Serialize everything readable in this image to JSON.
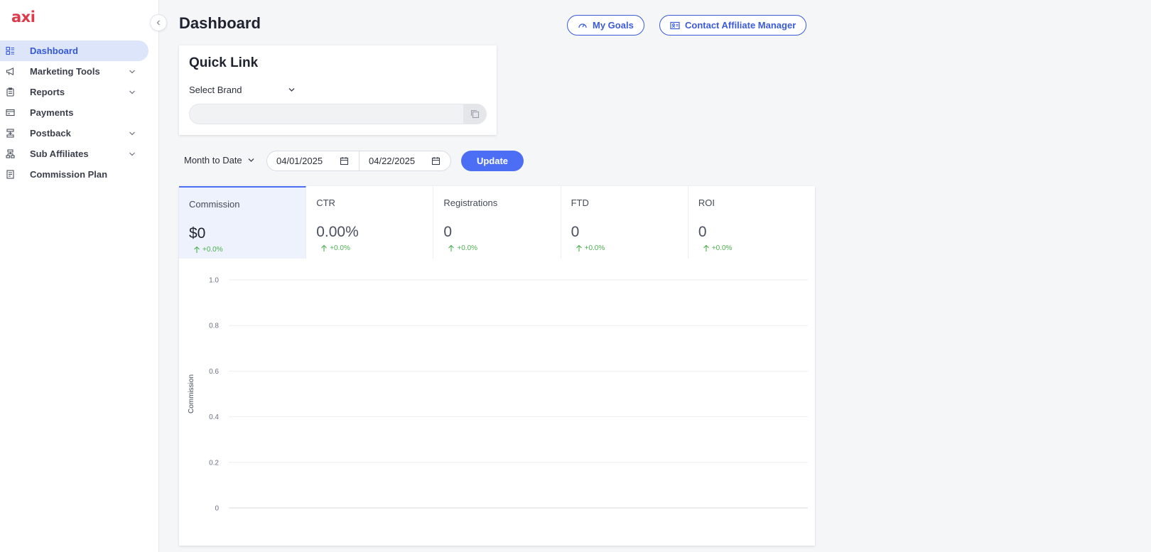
{
  "brand": {
    "logo_text": "axi",
    "color": "#e0394a"
  },
  "sidebar": {
    "items": [
      {
        "label": "Dashboard",
        "icon": "dashboard-icon",
        "expandable": false,
        "active": true
      },
      {
        "label": "Marketing Tools",
        "icon": "megaphone-icon",
        "expandable": true,
        "active": false
      },
      {
        "label": "Reports",
        "icon": "clipboard-icon",
        "expandable": true,
        "active": false
      },
      {
        "label": "Payments",
        "icon": "credit-card-icon",
        "expandable": false,
        "active": false
      },
      {
        "label": "Postback",
        "icon": "postback-icon",
        "expandable": true,
        "active": false
      },
      {
        "label": "Sub Affiliates",
        "icon": "hierarchy-icon",
        "expandable": true,
        "active": false
      },
      {
        "label": "Commission Plan",
        "icon": "document-icon",
        "expandable": false,
        "active": false
      }
    ]
  },
  "header": {
    "title": "Dashboard",
    "my_goals_label": "My Goals",
    "contact_label": "Contact Affiliate Manager"
  },
  "quick_link": {
    "title": "Quick Link",
    "brand_select_label": "Select Brand",
    "link_value": ""
  },
  "filters": {
    "period_label": "Month to Date",
    "start_date": "04/01/2025",
    "end_date": "04/22/2025",
    "update_label": "Update"
  },
  "metrics": [
    {
      "name": "Commission",
      "value": "$0",
      "change": "+0.0%",
      "active": true
    },
    {
      "name": "CTR",
      "value": "0.00%",
      "change": "+0.0%",
      "active": false
    },
    {
      "name": "Registrations",
      "value": "0",
      "change": "+0.0%",
      "active": false
    },
    {
      "name": "FTD",
      "value": "0",
      "change": "+0.0%",
      "active": false
    },
    {
      "name": "ROI",
      "value": "0",
      "change": "+0.0%",
      "active": false
    }
  ],
  "colors": {
    "accent": "#4c6ef5",
    "positive": "#4caf50",
    "active_nav_bg": "#dde5fb"
  },
  "chart_data": {
    "type": "line",
    "title": "",
    "ylabel": "Commission",
    "xlabel": "",
    "ylim": [
      0,
      1
    ],
    "yticks": [
      "1.0",
      "0.8",
      "0.6",
      "0.4",
      "0.2",
      "0"
    ],
    "series": [],
    "grid": true
  }
}
